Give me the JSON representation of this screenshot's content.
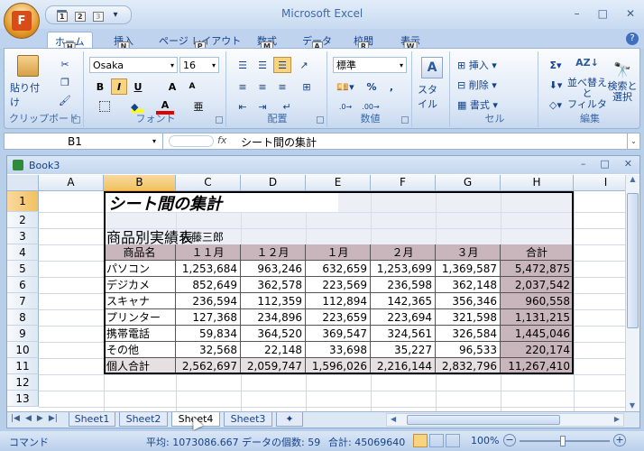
{
  "app": {
    "title": "Microsoft Excel",
    "window_controls": [
      "–",
      "□",
      "✕"
    ]
  },
  "qat": {
    "buttons": [
      {
        "badge": "1",
        "icon": "save-icon"
      },
      {
        "badge": "2",
        "icon": "undo-icon"
      },
      {
        "badge": "3",
        "icon": "redo-icon"
      }
    ],
    "more": "▾"
  },
  "tabs": [
    {
      "label": "ホーム",
      "key": "H"
    },
    {
      "label": "挿入",
      "key": "N"
    },
    {
      "label": "ページ レイアウト",
      "key": "P"
    },
    {
      "label": "数式",
      "key": "M"
    },
    {
      "label": "データ",
      "key": "A"
    },
    {
      "label": "校閲",
      "key": "R"
    },
    {
      "label": "表示",
      "key": "W"
    }
  ],
  "ribbon": {
    "clipboard": {
      "label": "クリップボード",
      "paste": "貼り付け"
    },
    "font": {
      "label": "フォント",
      "name": "Osaka",
      "size": "16",
      "bold": "B",
      "italic": "I",
      "underline": "U",
      "grow": "A",
      "shrink": "A",
      "color_a": "A",
      "phonetic": "亜"
    },
    "alignment": {
      "label": "配置"
    },
    "number": {
      "label": "数値",
      "format": "標準",
      "percent": "%",
      "comma": ","
    },
    "styles": {
      "label": "スタイル"
    },
    "cells": {
      "label": "セル",
      "insert": "挿入",
      "delete": "削除",
      "format": "書式"
    },
    "editing": {
      "label": "編集",
      "sort": "並べ替えと\nフィルタ",
      "find": "検索と\n選択",
      "sigma": "Σ"
    }
  },
  "formula_bar": {
    "name_box": "B1",
    "fx": "fx",
    "content": "シート間の集計"
  },
  "workbook": {
    "title": "Book3",
    "controls": [
      "–",
      "□",
      "✕"
    ]
  },
  "columns": [
    "A",
    "B",
    "C",
    "D",
    "E",
    "F",
    "G",
    "H",
    "I"
  ],
  "rows": [
    "1",
    "2",
    "3",
    "4",
    "5",
    "6",
    "7",
    "8",
    "9",
    "10",
    "11",
    "12",
    "13"
  ],
  "sheet": {
    "title": "シート間の集計",
    "subtitle": "商品別実績表",
    "author": "佐藤三郎",
    "headers": [
      "商品名",
      "１１月",
      "１２月",
      "１月",
      "２月",
      "３月",
      "合計"
    ],
    "body": [
      [
        "パソコン",
        "1,253,684",
        "963,246",
        "632,659",
        "1,253,699",
        "1,369,587",
        "5,472,875"
      ],
      [
        "デジカメ",
        "852,649",
        "362,578",
        "223,569",
        "236,598",
        "362,148",
        "2,037,542"
      ],
      [
        "スキャナ",
        "236,594",
        "112,359",
        "112,894",
        "142,365",
        "356,346",
        "960,558"
      ],
      [
        "プリンター",
        "127,368",
        "234,896",
        "223,659",
        "223,694",
        "321,598",
        "1,131,215"
      ],
      [
        "携帯電話",
        "59,834",
        "364,520",
        "369,547",
        "324,561",
        "326,584",
        "1,445,046"
      ],
      [
        "その他",
        "32,568",
        "22,148",
        "33,698",
        "35,227",
        "96,533",
        "220,174"
      ],
      [
        "個人合計",
        "2,562,697",
        "2,059,747",
        "1,596,026",
        "2,216,144",
        "2,832,796",
        "11,267,410"
      ]
    ]
  },
  "sheet_tabs": [
    "Sheet1",
    "Sheet2",
    "Sheet4",
    "Sheet3"
  ],
  "active_sheet": "Sheet4",
  "status": {
    "mode": "コマンド",
    "average": "平均: 1073086.667",
    "count": "データの個数: 59",
    "sum": "合計: 45069640",
    "zoom": "100%"
  },
  "colors": {
    "header_fill": "#c9b6bc",
    "selection": "#f1c15f",
    "ribbon_text": "#15428b"
  }
}
